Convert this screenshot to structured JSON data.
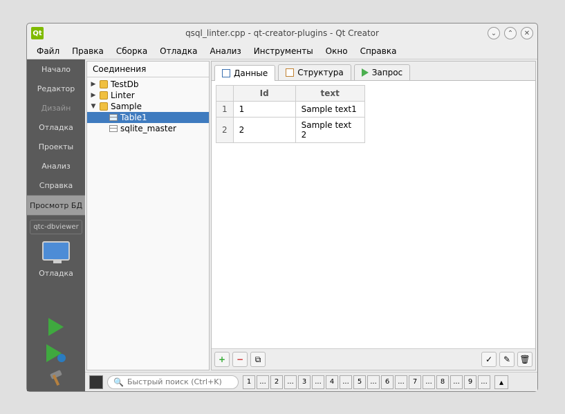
{
  "window": {
    "title": "qsql_linter.cpp - qt-creator-plugins - Qt Creator",
    "icon_label": "Qt"
  },
  "menubar": [
    "Файл",
    "Правка",
    "Сборка",
    "Отладка",
    "Анализ",
    "Инструменты",
    "Окно",
    "Справка"
  ],
  "sidebar": {
    "modes": [
      {
        "label": "Начало",
        "dim": false
      },
      {
        "label": "Редактор",
        "dim": false
      },
      {
        "label": "Дизайн",
        "dim": true
      },
      {
        "label": "Отладка",
        "dim": false
      },
      {
        "label": "Проекты",
        "dim": false
      },
      {
        "label": "Анализ",
        "dim": false
      },
      {
        "label": "Справка",
        "dim": false
      }
    ],
    "db_view": "Просмотр БД",
    "project": "qtc-dbviewer",
    "dbg_label": "Отладка"
  },
  "tree": {
    "title": "Соединения",
    "nodes": [
      {
        "label": "TestDb",
        "expanded": false,
        "level": 0,
        "type": "db"
      },
      {
        "label": "Linter",
        "expanded": false,
        "level": 0,
        "type": "db"
      },
      {
        "label": "Sample",
        "expanded": true,
        "level": 0,
        "type": "db"
      },
      {
        "label": "Table1",
        "level": 1,
        "type": "table",
        "selected": true
      },
      {
        "label": "sqlite_master",
        "level": 1,
        "type": "table"
      }
    ]
  },
  "tabs": [
    {
      "label": "Данные",
      "active": true,
      "icon": "data"
    },
    {
      "label": "Структура",
      "active": false,
      "icon": "struct"
    },
    {
      "label": "Запрос",
      "active": false,
      "icon": "query"
    }
  ],
  "grid": {
    "headers": [
      "Id",
      "text"
    ],
    "rows": [
      {
        "n": "1",
        "cells": [
          "1",
          "Sample text1"
        ]
      },
      {
        "n": "2",
        "cells": [
          "2",
          "Sample text 2"
        ]
      }
    ]
  },
  "search": {
    "placeholder": "Быстрый поиск (Ctrl+K)"
  },
  "pager": [
    "1",
    "...",
    "2",
    "...",
    "3",
    "...",
    "4",
    "...",
    "5",
    "...",
    "6",
    "...",
    "7",
    "...",
    "8",
    "...",
    "9",
    "..."
  ]
}
